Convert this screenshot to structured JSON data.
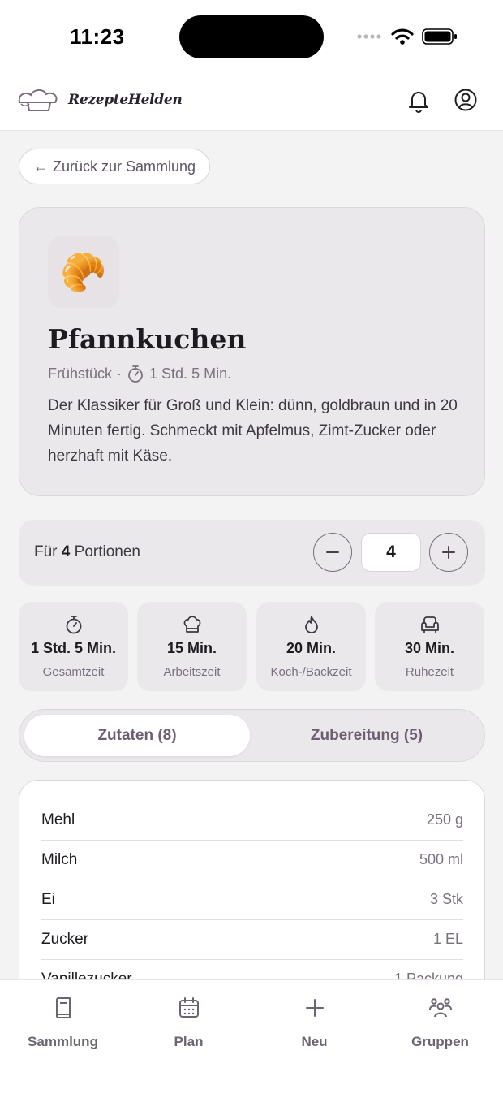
{
  "status_bar": {
    "time": "11:23"
  },
  "app": {
    "name": "RezepteHelden"
  },
  "back_button": {
    "label": "Zurück zur Sammlung",
    "arrow": "←"
  },
  "recipe": {
    "emoji": "🥐",
    "title": "Pfannkuchen",
    "category": "Frühstück",
    "separator": "·",
    "total_time": "1 Std. 5 Min.",
    "description": "Der Klassiker für Groß und Klein: dünn, goldbraun und in 20 Minuten fertig. Schmeckt mit Apfelmus, Zimt-Zucker oder herzhaft mit Käse."
  },
  "servings": {
    "prefix": "Für",
    "count": "4",
    "suffix": "Portionen",
    "input_value": "4"
  },
  "stats": [
    {
      "icon": "stopwatch-icon",
      "value": "1 Std. 5 Min.",
      "label": "Gesamtzeit"
    },
    {
      "icon": "chef-hat-icon",
      "value": "15 Min.",
      "label": "Arbeitszeit"
    },
    {
      "icon": "flame-icon",
      "value": "20 Min.",
      "label": "Koch-/Backzeit"
    },
    {
      "icon": "armchair-icon",
      "value": "30 Min.",
      "label": "Ruhezeit"
    }
  ],
  "tabs": [
    {
      "label": "Zutaten (8)",
      "active": true
    },
    {
      "label": "Zubereitung (5)",
      "active": false
    }
  ],
  "ingredients": [
    {
      "name": "Mehl",
      "qty": "250 g"
    },
    {
      "name": "Milch",
      "qty": "500 ml"
    },
    {
      "name": "Ei",
      "qty": "3 Stk"
    },
    {
      "name": "Zucker",
      "qty": "1 EL"
    },
    {
      "name": "Vanillezucker",
      "qty": "1 Packung"
    }
  ],
  "bottom_nav": [
    {
      "icon": "book-icon",
      "label": "Sammlung"
    },
    {
      "icon": "calendar-icon",
      "label": "Plan"
    },
    {
      "icon": "plus-icon",
      "label": "Neu"
    },
    {
      "icon": "group-icon",
      "label": "Gruppen"
    }
  ],
  "colors": {
    "accent": "#7a6b7f",
    "surface": "#ebe8ec",
    "background": "#f4f3f4"
  }
}
